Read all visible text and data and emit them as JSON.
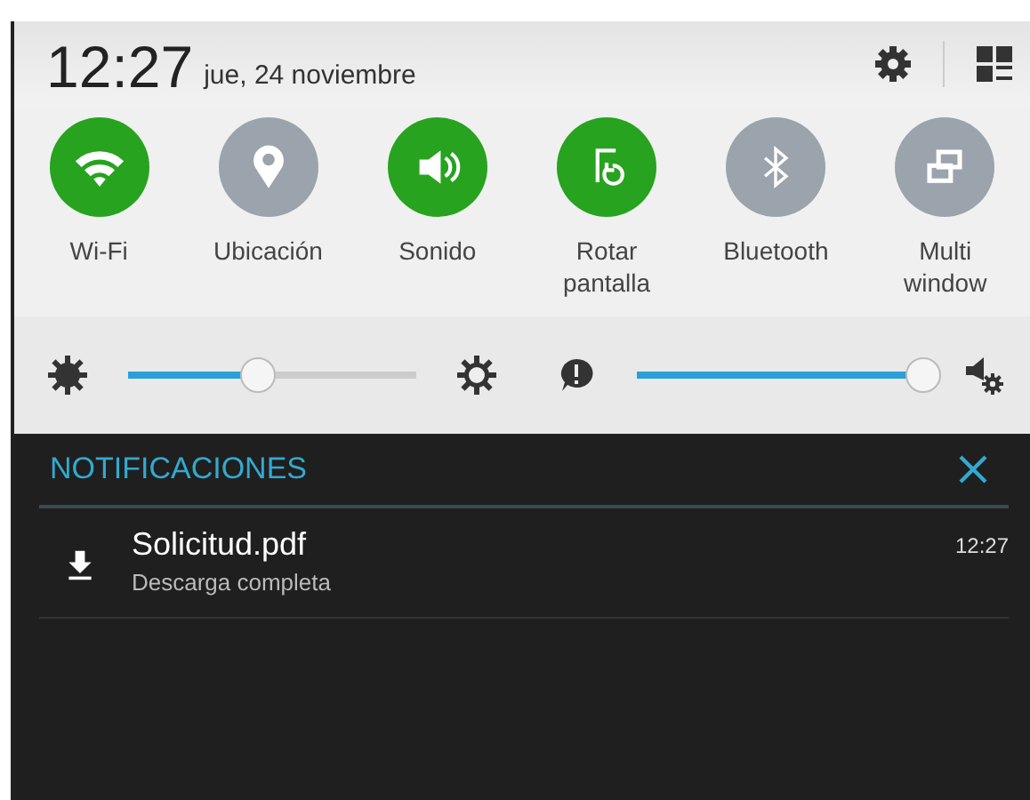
{
  "header": {
    "time": "12:27",
    "date": "jue, 24 noviembre"
  },
  "toggles": [
    {
      "kind": "wifi",
      "label": "Wi-Fi",
      "on": true
    },
    {
      "kind": "location",
      "label": "Ubicación",
      "on": false
    },
    {
      "kind": "sound",
      "label": "Sonido",
      "on": true
    },
    {
      "kind": "rotate",
      "label": "Rotar pantalla",
      "on": true
    },
    {
      "kind": "bluetooth",
      "label": "Bluetooth",
      "on": false
    },
    {
      "kind": "multiwindow",
      "label": "Multi window",
      "on": false
    }
  ],
  "sliders": [
    {
      "kind": "brightness",
      "level": 0.45
    },
    {
      "kind": "volume",
      "level": 1.0
    }
  ],
  "notifications": {
    "title": "NOTIFICACIONES",
    "items": [
      {
        "title": "Solicitud.pdf",
        "subtitle": "Descarga completa",
        "time": "12:27"
      }
    ]
  }
}
